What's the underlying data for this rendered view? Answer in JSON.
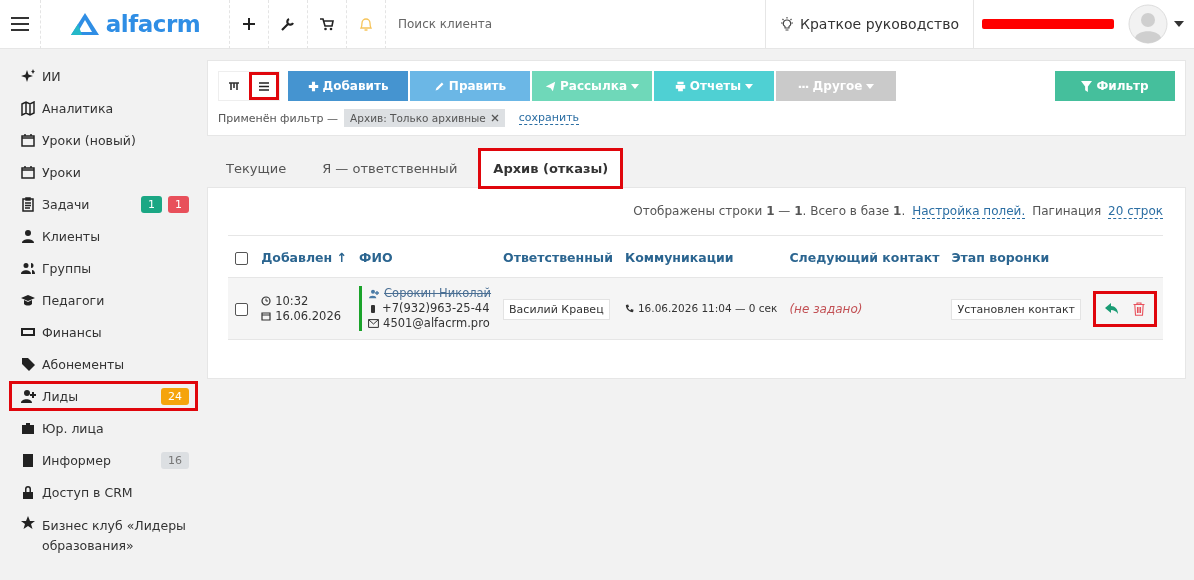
{
  "header": {
    "logo": "alfacrm",
    "search": {
      "placeholder": "Поиск клиента"
    },
    "guide": "Краткое руководство"
  },
  "sidebar": {
    "items": [
      {
        "kind": "sparkle",
        "label": "ИИ",
        "selected": false
      },
      {
        "kind": "map",
        "label": "Аналитика",
        "selected": false
      },
      {
        "kind": "calendar",
        "label": "Уроки (новый)",
        "selected": false
      },
      {
        "kind": "calendar",
        "label": "Уроки",
        "selected": false
      },
      {
        "kind": "clipboard",
        "label": "Задачи",
        "selected": false,
        "badges": [
          {
            "text": "1",
            "color": "#1ba784"
          },
          {
            "text": "1",
            "color": "#e8505b"
          }
        ]
      },
      {
        "kind": "user",
        "label": "Клиенты",
        "selected": false
      },
      {
        "kind": "users",
        "label": "Группы",
        "selected": false
      },
      {
        "kind": "cap",
        "label": "Педагоги",
        "selected": false
      },
      {
        "kind": "money",
        "label": "Финансы",
        "selected": false
      },
      {
        "kind": "tag",
        "label": "Абонементы",
        "selected": false
      },
      {
        "kind": "user-plus",
        "label": "Лиды",
        "selected": true,
        "badges": [
          {
            "text": "24",
            "color": "#f5a40c"
          }
        ]
      },
      {
        "kind": "briefcase",
        "label": "Юр. лица",
        "selected": false
      },
      {
        "kind": "book",
        "label": "Информер",
        "selected": false,
        "badges": [
          {
            "text": "16",
            "color": "#dcdfe2"
          }
        ]
      },
      {
        "kind": "lock",
        "label": "Доступ в CRM",
        "selected": false
      },
      {
        "kind": "star",
        "label": "Бизнес клуб «Лидеры образования»",
        "selected": false
      }
    ]
  },
  "toolbar": {
    "views": [
      {
        "kind": "grid",
        "selected": false
      },
      {
        "kind": "list",
        "selected": true
      }
    ],
    "buttons": [
      {
        "kind": "add",
        "label": "Добавить",
        "color": "#4594d0",
        "caret": false
      },
      {
        "kind": "edit",
        "label": "Править",
        "color": "#6bb7e6",
        "caret": false
      },
      {
        "kind": "send",
        "label": "Рассылка",
        "color": "#6fd8b9",
        "caret": true
      },
      {
        "kind": "print",
        "label": "Отчеты",
        "color": "#4fd0d3",
        "caret": true
      },
      {
        "kind": "more",
        "label": "Другое",
        "color": "#cacaca",
        "caret": true
      }
    ],
    "filter_button": "Фильтр",
    "filter_label": "Применён фильтр —",
    "filter_chip": "Архив: Только архивные",
    "save_link": "сохранить"
  },
  "tabs": [
    {
      "label": "Текущие",
      "selected": false
    },
    {
      "label": "Я — ответственный",
      "selected": false
    },
    {
      "label": "Архив (отказы)",
      "selected": true
    }
  ],
  "summary": {
    "text": "Отображены строки **1** — **1**. Всего в базе **1**.",
    "settings_link": "Настройка полей.",
    "pagination_label": "Пагинация",
    "pagination_link": "20 строк"
  },
  "table": {
    "select_all_checked": false,
    "columns": [
      "Добавлен ↑",
      "ФИО",
      "Ответственный",
      "Коммуникации",
      "Следующий контакт",
      "Этап воронки"
    ],
    "rows": [
      {
        "checked": false,
        "time": "10:32",
        "date": "16.06.2026",
        "name": "Сорокин Николай",
        "archived": true,
        "color": "#1aa32a",
        "phone": "+7(932)963-25-44",
        "email": "4501@alfacrm.pro",
        "responsible": "Василий Кравец",
        "communication": "16.06.2026 11:04 — 0 сек",
        "next_contact": "(не задано)",
        "stage": "Установлен контакт",
        "actions_highlighted": true
      }
    ]
  }
}
